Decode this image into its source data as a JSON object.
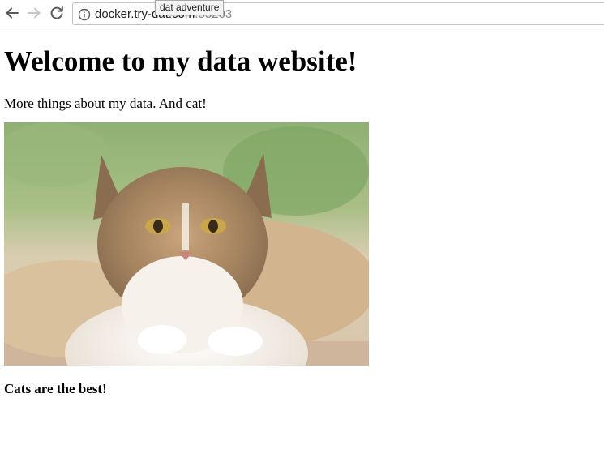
{
  "browser": {
    "url_host": "docker.try-dat.com",
    "url_port": ":55203",
    "tooltip": "dat adventure",
    "icons": {
      "back": "back-arrow-icon",
      "forward": "forward-arrow-icon",
      "reload": "reload-icon",
      "site_info": "info-icon"
    }
  },
  "page": {
    "heading": "Welcome to my data website!",
    "intro": "More things about my data. And cat!",
    "image_subject": "cat",
    "caption": "Cats are the best!"
  }
}
